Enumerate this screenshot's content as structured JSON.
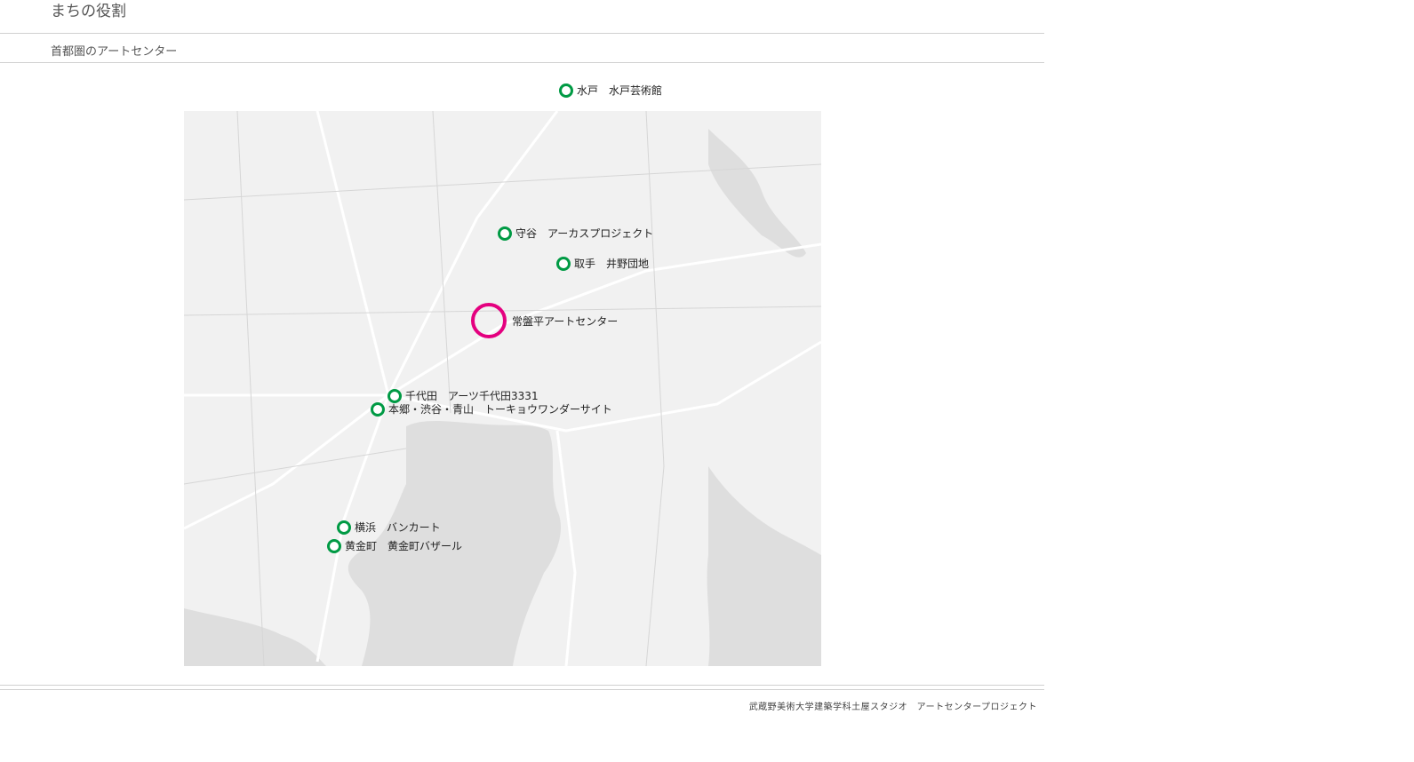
{
  "page": {
    "title": "まちの役割",
    "subtitle": "首都圏のアートセンター"
  },
  "map": {
    "colors": {
      "land": "#f1f1f1",
      "water": "#dedede",
      "roads": "#ffffff",
      "marker": "#009a44",
      "highlight": "#e4007f"
    },
    "markers": [
      {
        "label": "水戸　水戸芸術館"
      },
      {
        "label": "守谷　アーカスプロジェクト"
      },
      {
        "label": "取手　井野団地"
      },
      {
        "label": "常盤平アートセンター",
        "highlight": true
      },
      {
        "label": "千代田　アーツ千代田3331"
      },
      {
        "label": "本郷・渋谷・青山　トーキョウワンダーサイト"
      },
      {
        "label": "横浜　バンカート"
      },
      {
        "label": "黄金町　黄金町バザール"
      }
    ]
  },
  "footer": {
    "credit": "武蔵野美術大学建築学科土屋スタジオ　アートセンタープロジェクト"
  }
}
